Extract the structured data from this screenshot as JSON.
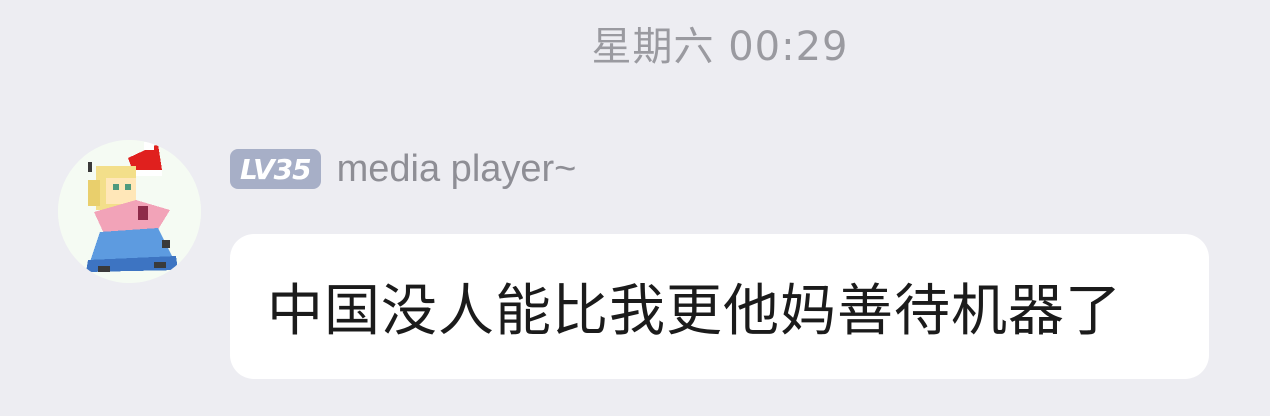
{
  "timestamp": "星期六 00:29",
  "message": {
    "sender": {
      "level_badge": "LV35",
      "name": "media player~"
    },
    "text": "中国没人能比我更他妈善待机器了"
  },
  "colors": {
    "background": "#ededf2",
    "bubble": "#ffffff",
    "badge": "#a7afc7",
    "muted_text": "#9a9aa0"
  },
  "icons": {
    "avatar": "pixel-character-avatar"
  }
}
